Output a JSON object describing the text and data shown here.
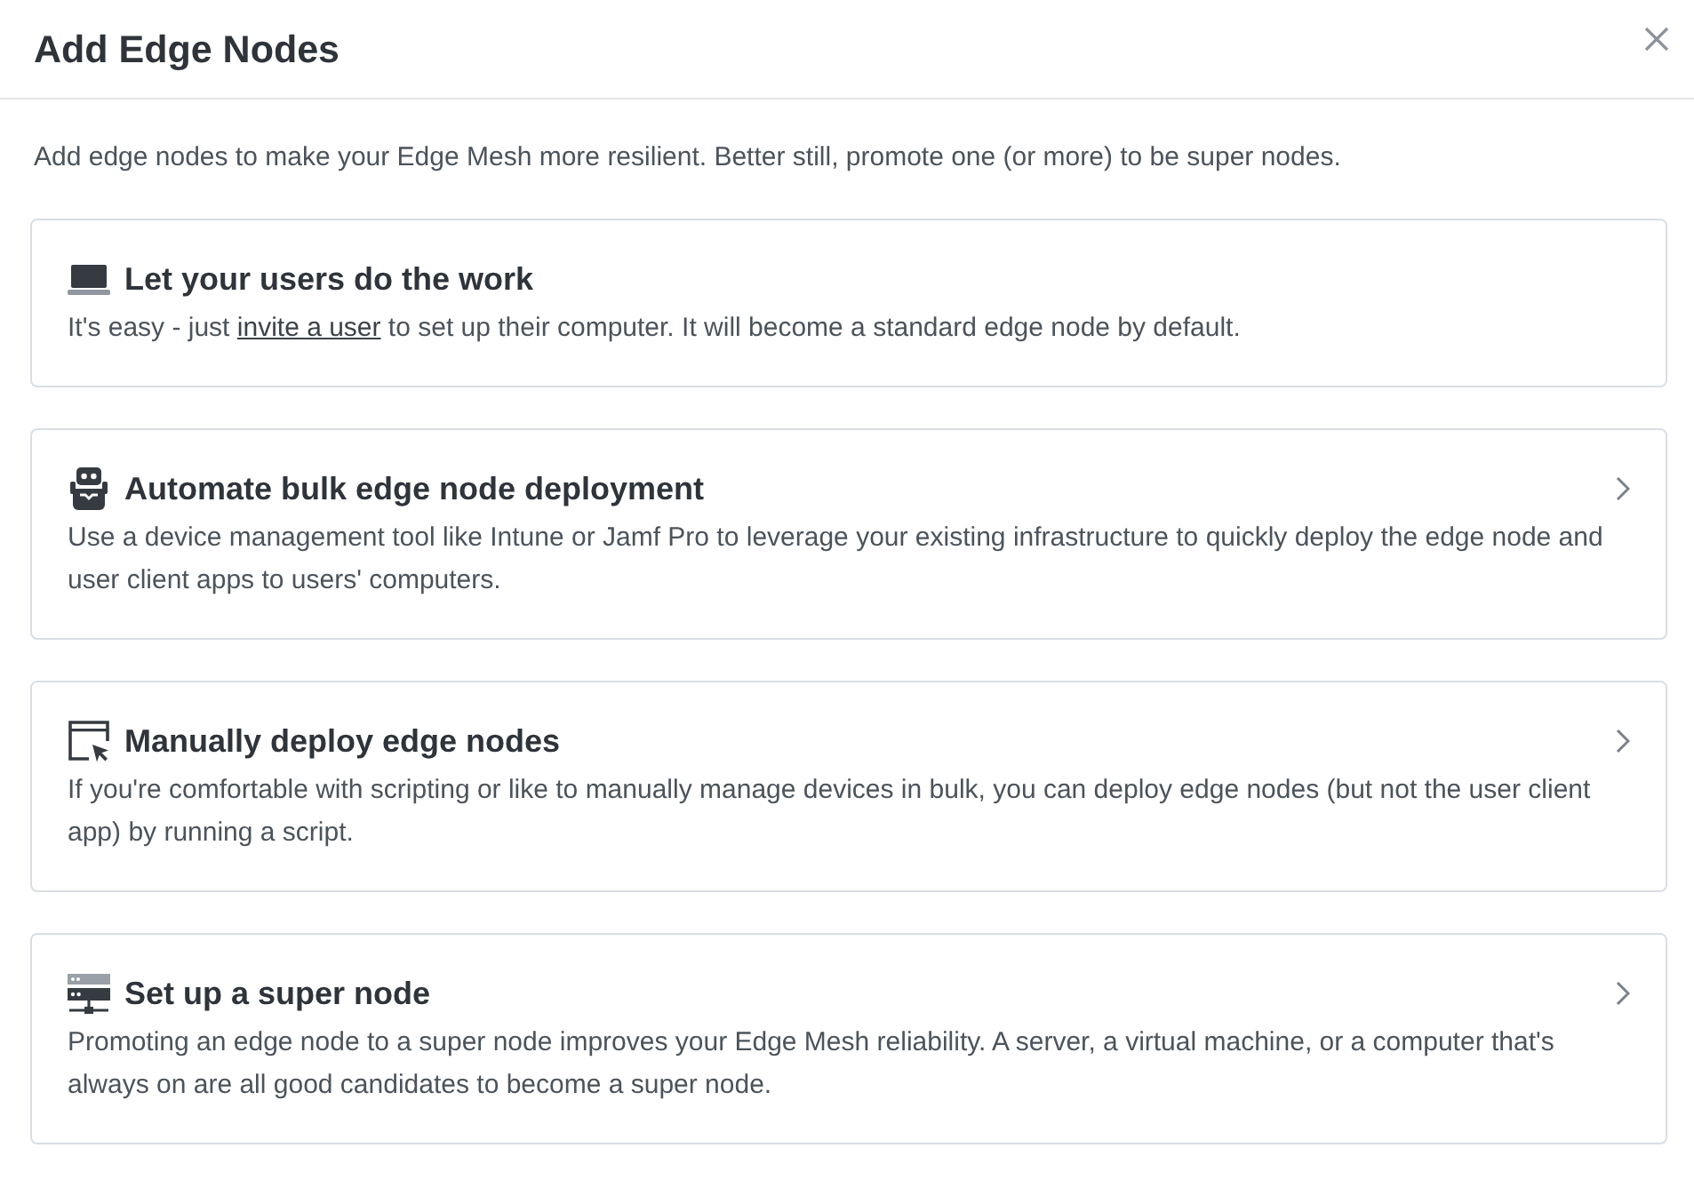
{
  "dialog": {
    "title": "Add Edge Nodes"
  },
  "intro": "Add edge nodes to make your Edge Mesh more resilient. Better still, promote one (or more) to be super nodes.",
  "options": [
    {
      "kind": "static",
      "title": "Let your users do the work",
      "description": [
        {
          "kind": "text",
          "text": "It's easy - just "
        },
        {
          "kind": "link",
          "text": "invite a user"
        },
        {
          "kind": "text",
          "text": " to set up their computer. It will become a standard edge node by default."
        }
      ]
    },
    {
      "kind": "navigate",
      "title": "Automate bulk edge node deployment",
      "description": [
        {
          "kind": "text",
          "text": "Use a device management tool like Intune or Jamf Pro to leverage your existing infrastructure to quickly deploy the edge node and user client apps to users' computers."
        }
      ]
    },
    {
      "kind": "navigate",
      "title": "Manually deploy edge nodes",
      "description": [
        {
          "kind": "text",
          "text": "If you're comfortable with scripting or like to manually manage devices in bulk, you can deploy edge nodes (but not the user client app) by running a script."
        }
      ]
    },
    {
      "kind": "navigate",
      "title": "Set up a super node",
      "description": [
        {
          "kind": "text",
          "text": "Promoting an edge node to a super node improves your Edge Mesh reliability. A server, a virtual machine, or a computer that's always on are all good candidates to become a super node."
        }
      ]
    }
  ]
}
